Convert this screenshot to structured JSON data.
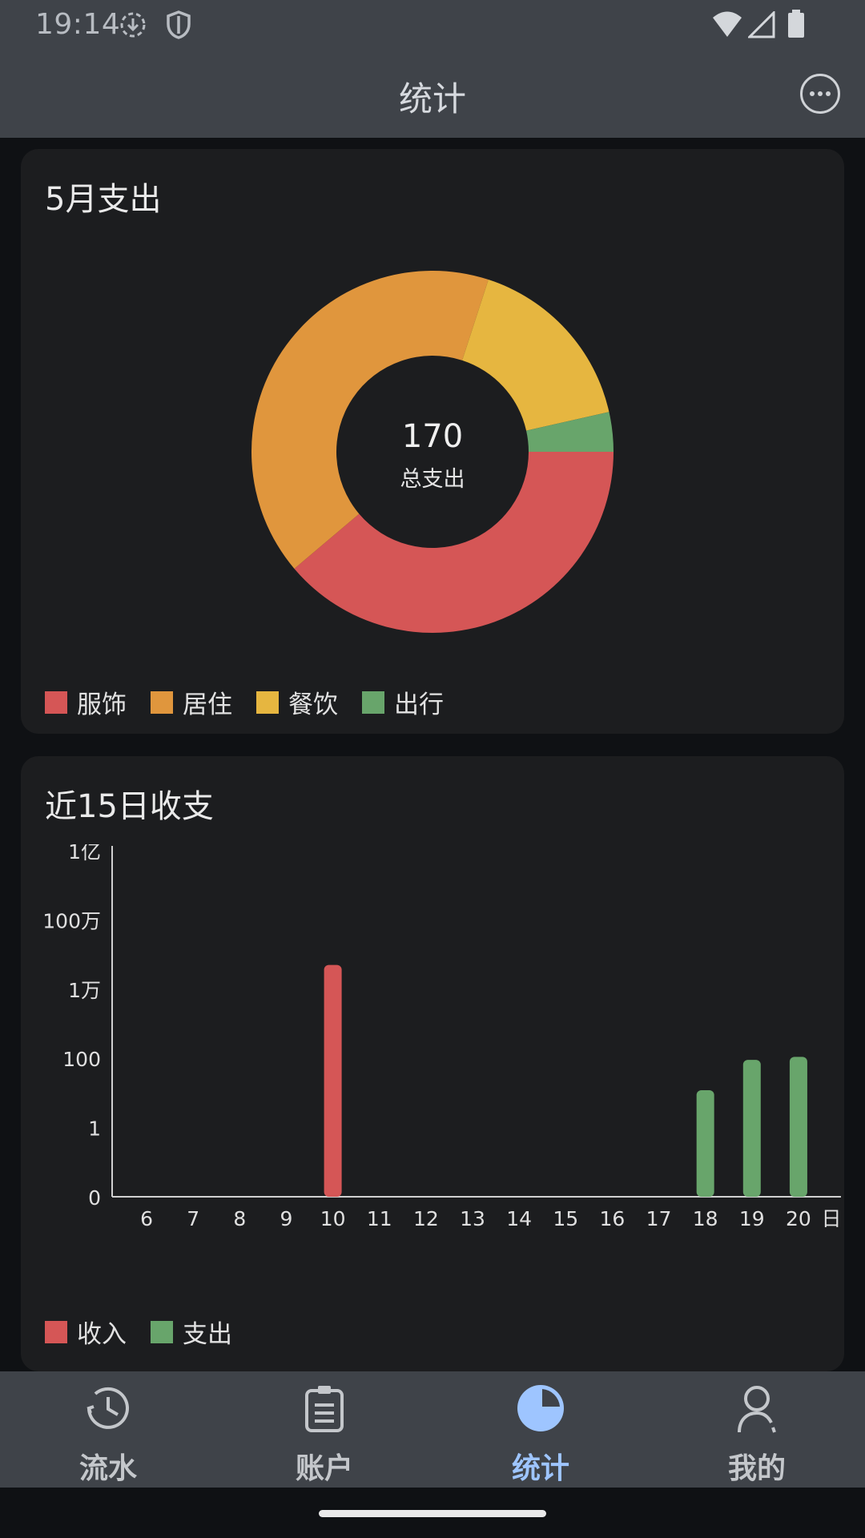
{
  "status_bar": {
    "time": "19:14",
    "icons": [
      "download-icon",
      "shield-icon",
      "wifi-icon",
      "signal-icon",
      "battery-icon"
    ]
  },
  "app_bar": {
    "title": "统计",
    "more_icon": "more-horizontal-icon"
  },
  "monthly_card": {
    "title": "5月支出",
    "center_value": "170",
    "center_label": "总支出",
    "legend": [
      {
        "label": "服饰",
        "color": "#d55656"
      },
      {
        "label": "居住",
        "color": "#e0963d"
      },
      {
        "label": "餐饮",
        "color": "#e6b640"
      },
      {
        "label": "出行",
        "color": "#68a56b"
      }
    ]
  },
  "daily_card": {
    "title": "近15日收支",
    "legend": [
      {
        "label": "收入",
        "color": "#d55656"
      },
      {
        "label": "支出",
        "color": "#68a56b"
      }
    ]
  },
  "chart_data": [
    {
      "type": "pie",
      "title": "5月支出",
      "categories": [
        "服饰",
        "居住",
        "餐饮",
        "出行"
      ],
      "values": [
        66,
        70,
        28,
        6
      ],
      "total": 170,
      "colors": [
        "#d55656",
        "#e0963d",
        "#e6b640",
        "#68a56b"
      ],
      "donut": true,
      "legend_position": "bottom-left"
    },
    {
      "type": "bar",
      "title": "近15日收支",
      "x_unit": "日",
      "categories": [
        "6",
        "7",
        "8",
        "9",
        "10",
        "11",
        "12",
        "13",
        "14",
        "15",
        "16",
        "17",
        "18",
        "19",
        "20"
      ],
      "y_scale": "log",
      "y_ticks": [
        "0",
        "1",
        "100",
        "1万",
        "100万",
        "1亿"
      ],
      "series": [
        {
          "name": "收入",
          "color": "#d55656",
          "values": [
            0,
            0,
            0,
            0,
            50000,
            0,
            0,
            0,
            0,
            0,
            0,
            0,
            0,
            0,
            0
          ]
        },
        {
          "name": "支出",
          "color": "#68a56b",
          "values": [
            0,
            0,
            0,
            0,
            0,
            0,
            0,
            0,
            0,
            0,
            0,
            0,
            12,
            90,
            110
          ]
        }
      ],
      "legend_position": "bottom-left"
    }
  ],
  "bottom_nav": {
    "items": [
      {
        "label": "流水",
        "icon": "clock-icon",
        "active": false
      },
      {
        "label": "账户",
        "icon": "clipboard-icon",
        "active": false
      },
      {
        "label": "统计",
        "icon": "pie-chart-icon",
        "active": true
      },
      {
        "label": "我的",
        "icon": "person-icon",
        "active": false
      }
    ]
  }
}
